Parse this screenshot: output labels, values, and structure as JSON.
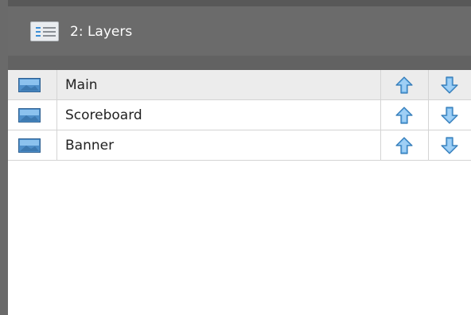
{
  "panel": {
    "title": "2: Layers",
    "icon": "layers-list-icon"
  },
  "layers": [
    {
      "name": "Main",
      "selected": true,
      "icon": "image-icon"
    },
    {
      "name": "Scoreboard",
      "selected": false,
      "icon": "image-icon"
    },
    {
      "name": "Banner",
      "selected": false,
      "icon": "image-icon"
    }
  ],
  "row_controls": {
    "up_icon": "arrow-up-icon",
    "down_icon": "arrow-down-icon"
  },
  "colors": {
    "title_bar": "#6b6b6b",
    "selected_row": "#ececec",
    "arrow_fill": "#6fb4ea",
    "arrow_stroke": "#2f77b5"
  }
}
